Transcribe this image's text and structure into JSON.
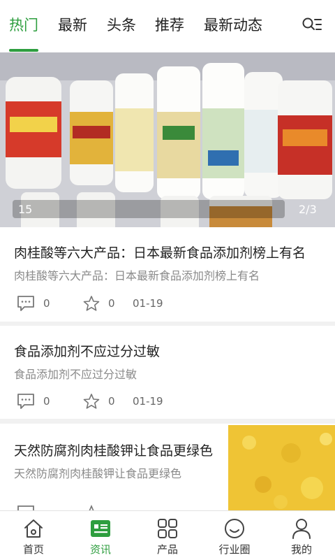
{
  "tabs": [
    {
      "label": "热门",
      "active": true
    },
    {
      "label": "最新"
    },
    {
      "label": "头条"
    },
    {
      "label": "推荐"
    },
    {
      "label": "最新动态"
    }
  ],
  "menu_icon": "search-list-icon",
  "banner": {
    "counter": "15",
    "page": "2/3"
  },
  "articles": [
    {
      "title": "肉桂酸等六大产品：日本最新食品添加剂榜上有名",
      "subtitle": "肉桂酸等六大产品：日本最新食品添加剂榜上有名",
      "comments": "0",
      "favorites": "0",
      "date": "01-19"
    },
    {
      "title": "食品添加剂不应过分过敏",
      "subtitle": "食品添加剂不应过分过敏",
      "comments": "0",
      "favorites": "0",
      "date": "01-19"
    },
    {
      "title": "天然防腐剂肉桂酸钾让食品更绿色",
      "subtitle": "天然防腐剂肉桂酸钾让食品更绿色"
    }
  ],
  "bottom_nav": [
    {
      "label": "首页",
      "icon": "home-icon"
    },
    {
      "label": "资讯",
      "icon": "news-icon",
      "active": true
    },
    {
      "label": "产品",
      "icon": "products-grid-icon"
    },
    {
      "label": "行业圈",
      "icon": "industry-circle-icon"
    },
    {
      "label": "我的",
      "icon": "profile-icon"
    }
  ],
  "colors": {
    "accent": "#2e9e3f",
    "text": "#222222",
    "subtext": "#8a8a8a",
    "background": "#f1f1f1"
  }
}
